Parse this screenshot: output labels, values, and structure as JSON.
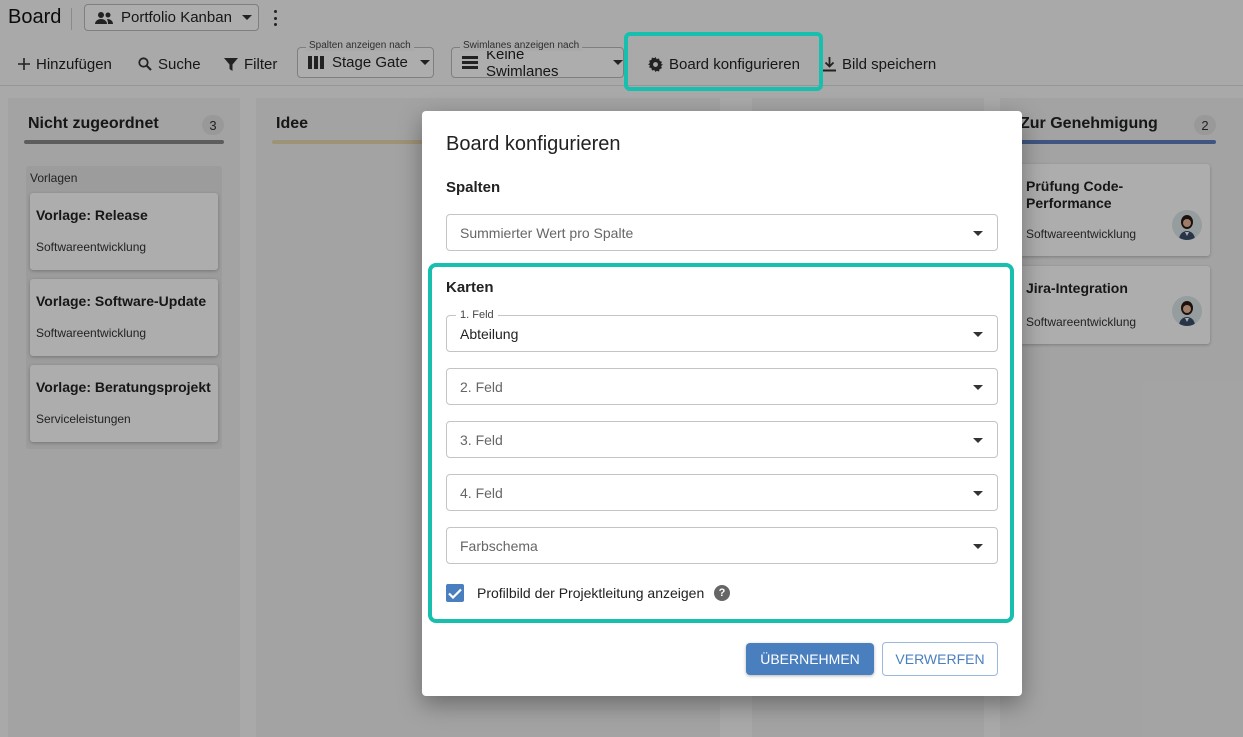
{
  "header": {
    "title": "Board",
    "portfolio_select": "Portfolio Kanban"
  },
  "toolbar": {
    "add_label": "Hinzufügen",
    "search_label": "Suche",
    "filter_label": "Filter",
    "columns_select": {
      "label": "Spalten anzeigen nach",
      "value": "Stage Gate"
    },
    "swimlanes_select": {
      "label": "Swimlanes anzeigen nach",
      "value": "Keine Swimlanes"
    },
    "configure_label": "Board konfigurieren",
    "save_image_label": "Bild speichern"
  },
  "columns": [
    {
      "title": "Nicht zugeordnet",
      "count": "3",
      "group": "Vorlagen",
      "cards": [
        {
          "title": "Vorlage: Release",
          "subtitle": "Softwareentwicklung"
        },
        {
          "title": "Vorlage: Software-Update",
          "subtitle": "Softwareentwicklung"
        },
        {
          "title": "Vorlage: Beratungsprojekt",
          "subtitle": "Serviceleistungen"
        }
      ]
    },
    {
      "title": "Idee"
    },
    {
      "title": "Zur Genehmigung",
      "count": "2",
      "cards": [
        {
          "title": "Prüfung Code-Performance",
          "subtitle": "Softwareentwicklung"
        },
        {
          "title": "Jira-Integration",
          "subtitle": "Softwareentwicklung"
        }
      ]
    }
  ],
  "colors": {
    "highlight": "#16bfae",
    "primary": "#4a7fbf",
    "bar_gray": "#8a8a8a",
    "bar_idee": "#e8d9b0",
    "bar_genehmigung": "#5f7fbf"
  },
  "dialog": {
    "title": "Board konfigurieren",
    "spalten_title": "Spalten",
    "spalten_field_placeholder": "Summierter Wert pro Spalte",
    "karten_title": "Karten",
    "field1_label": "1. Feld",
    "field1_value": "Abteilung",
    "field2_placeholder": "2. Feld",
    "field3_placeholder": "3. Feld",
    "field4_placeholder": "4. Feld",
    "color_scheme_placeholder": "Farbschema",
    "checkbox_label": "Profilbild der Projektleitung anzeigen",
    "checkbox_checked": true,
    "help_glyph": "?",
    "apply_label": "ÜBERNEHMEN",
    "discard_label": "VERWERFEN"
  }
}
